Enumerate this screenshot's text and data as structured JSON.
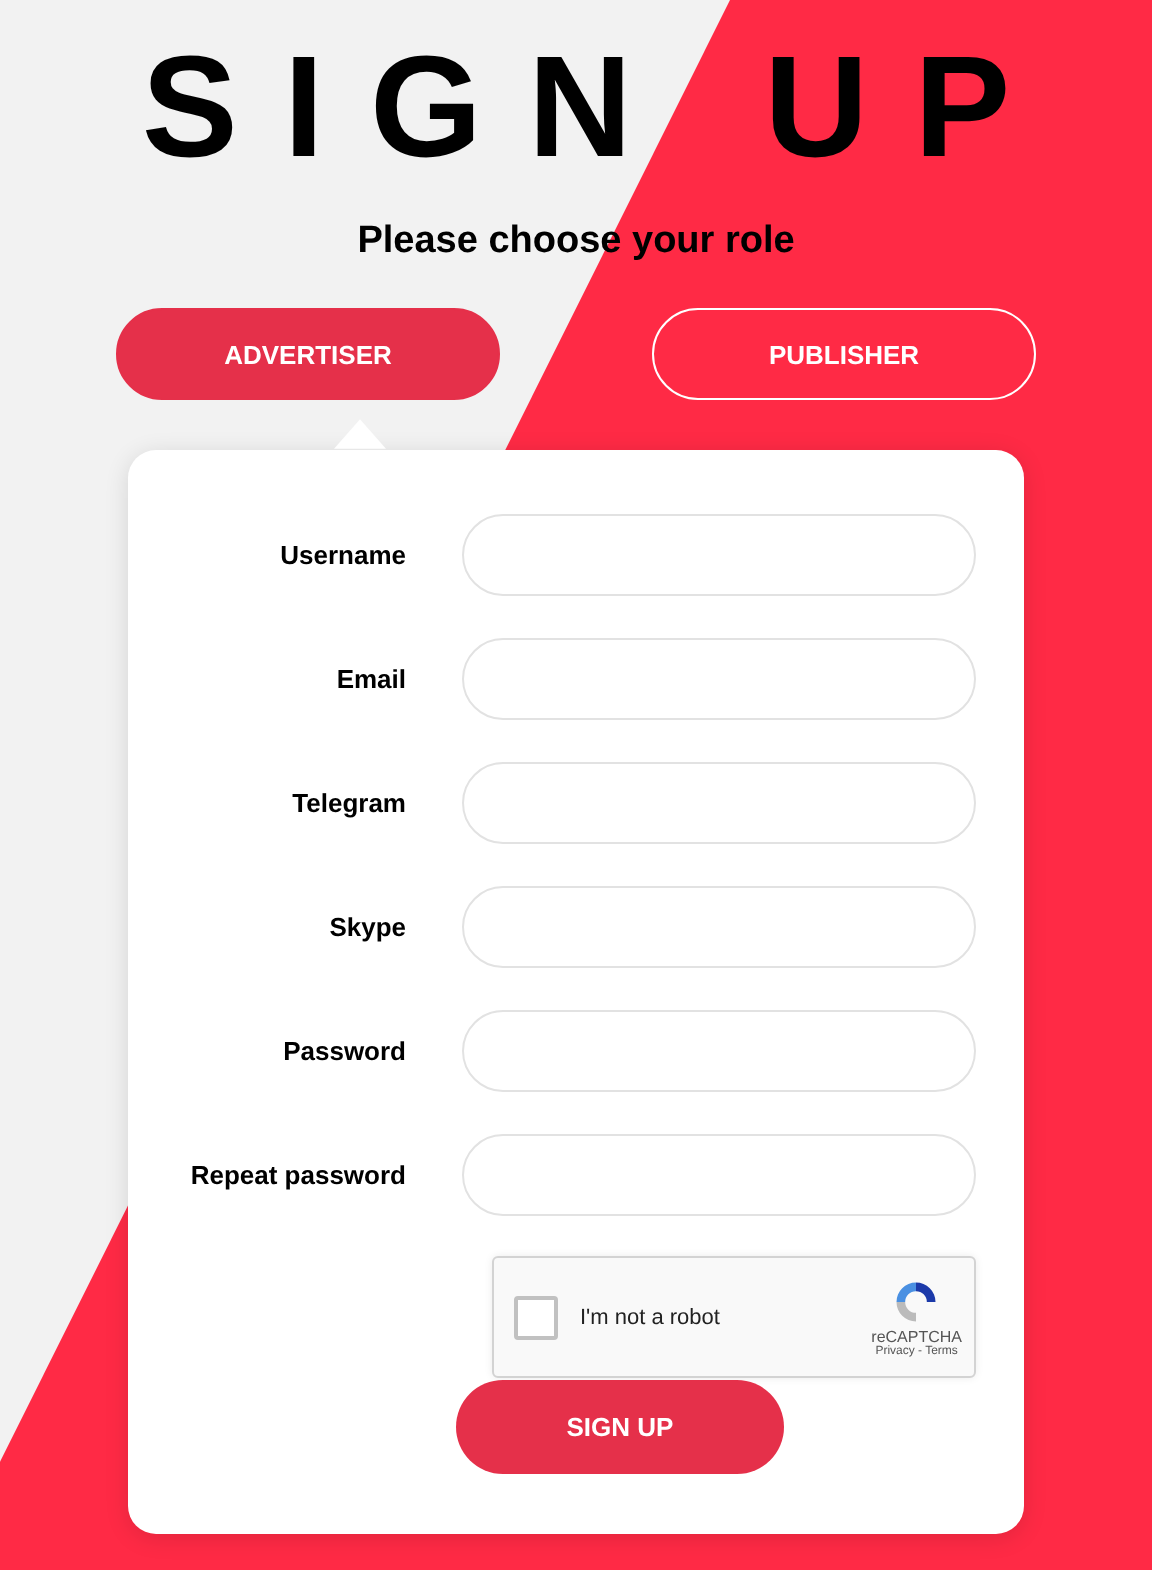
{
  "title": "SIGN UP",
  "subtitle": "Please choose your role",
  "roles": [
    {
      "label": "ADVERTISER",
      "selected": true
    },
    {
      "label": "PUBLISHER",
      "selected": false
    }
  ],
  "fields": [
    {
      "label": "Username"
    },
    {
      "label": "Email"
    },
    {
      "label": "Telegram"
    },
    {
      "label": "Skype"
    },
    {
      "label": "Password"
    },
    {
      "label": "Repeat password"
    }
  ],
  "captcha": {
    "label": "I'm not a robot",
    "checked": false,
    "brand": "reCAPTCHA",
    "links": "Privacy - Terms"
  },
  "submit": "SIGN UP"
}
